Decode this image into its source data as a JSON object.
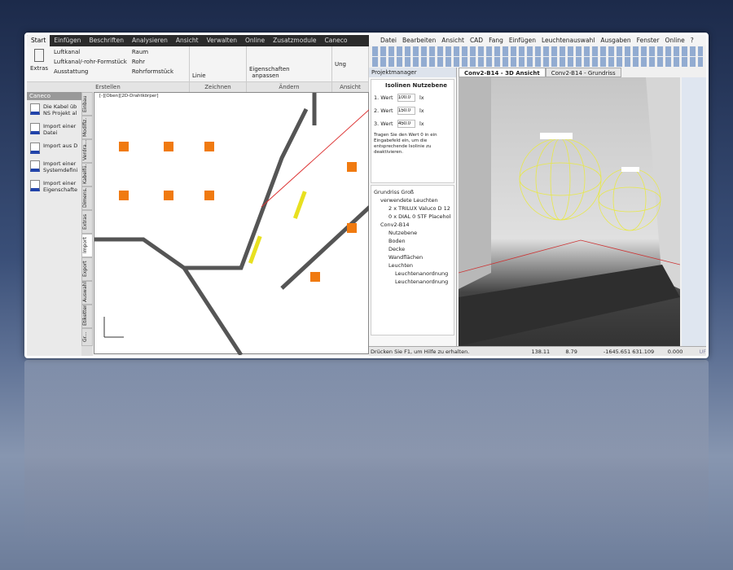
{
  "left_app": {
    "tabs": [
      "Start",
      "Einfügen",
      "Beschriften",
      "Analysieren",
      "Ansicht",
      "Verwalten",
      "Online",
      "Zusatzmodule",
      "Caneco"
    ],
    "ribbon": {
      "extras": "Extras",
      "create_items": [
        "Luftkanal",
        "Luftkanal/-rohr-Formstück",
        "Ausstattung",
        "Raum",
        "Rohr",
        "Rohrformstück"
      ],
      "linie": "Linie",
      "eigenschaften": "Eigenschaften anpassen",
      "ung": "Ung"
    },
    "groups": [
      "Erstellen",
      "Zeichnen",
      "Ändern",
      "Ansicht"
    ],
    "caneco": {
      "title": "Caneco",
      "items": [
        "Die Kabel üb NS Projekt al",
        "Import einer Datei",
        "Import aus D",
        "Import einer Systemdefini",
        "Import einer Eigenschafte"
      ]
    },
    "vertical_tabs": [
      "Einbau",
      "Modifiz.",
      "Verdra...",
      "Kabelfü...",
      "Dimens.",
      "Extras",
      "Import",
      "Export",
      "Auswahl",
      "Etiketten",
      "Gr..."
    ],
    "viewport_label": "[-][Oben][2D-Drahtkörper]"
  },
  "right_app": {
    "menu": [
      "Datei",
      "Bearbeiten",
      "Ansicht",
      "CAD",
      "Fang",
      "Einfügen",
      "Leuchtenauswahl",
      "Ausgaben",
      "Fenster",
      "Online",
      "?"
    ],
    "panel_title": "Projektmanager",
    "isolines": {
      "tab": "Isolinen Nutzebene",
      "rows": [
        {
          "label": "1. Wert",
          "value": "100.0",
          "unit": "lx"
        },
        {
          "label": "2. Wert",
          "value": "150.0",
          "unit": "lx"
        },
        {
          "label": "3. Wert",
          "value": "450.0",
          "unit": "lx"
        }
      ],
      "note": "Tragen Sie den Wert 0 in ein Eingabefeld ein, um die entsprechende Isolinie zu deaktivieren."
    },
    "tree": [
      "Grundriss Groß",
      "verwendete Leuchten",
      "2 x TRILUX Valuco D 12",
      "0 x DIAL 0 STF Placeholder",
      "Conv2-B14",
      "Nutzebene",
      "Boden",
      "Decke",
      "Wandflächen",
      "Leuchten",
      "Leuchtenanordnung",
      "Leuchtenanordnung"
    ],
    "doc_tabs": [
      "Conv2-B14 - 3D Ansicht",
      "Conv2-B14 - Grundriss"
    ],
    "status": {
      "help": "Drücken Sie F1, um Hilfe zu erhalten.",
      "illuminance": "138.11 lx",
      "luminance": "8.79 cd/m²",
      "coords": "-1645.651  631.109 m",
      "z": "0.000 m",
      "uf": "UF"
    }
  },
  "colors": {
    "accent_orange": "#f07a10",
    "sphere_yellow": "#e8e84a",
    "ribbon_dark": "#2b2b2b"
  }
}
